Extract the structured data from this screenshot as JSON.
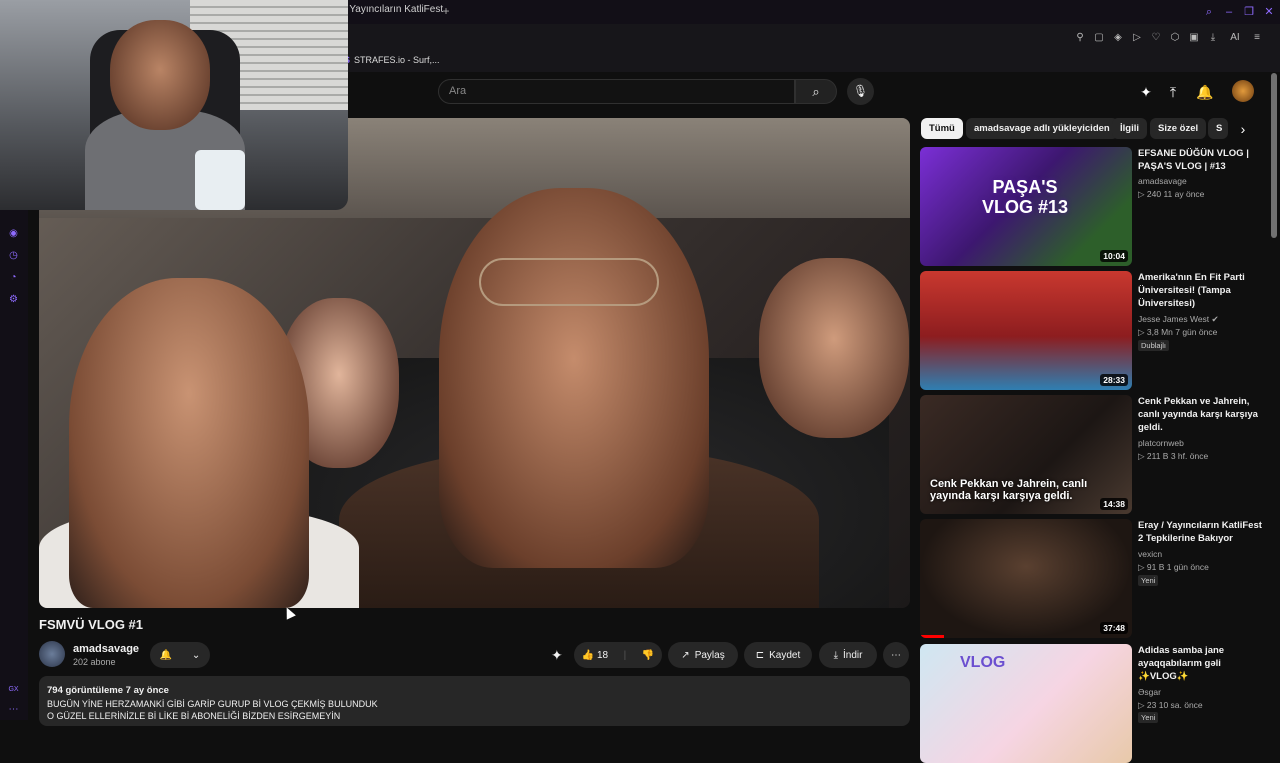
{
  "browser": {
    "tab_title": "/ Yayıncıların KatliFest",
    "new_tab": "+",
    "window_controls": [
      "search-icon",
      "minimize-icon",
      "restore-icon",
      "close-icon"
    ],
    "bookmark": {
      "icon_letter": "S",
      "label": "STRAFES.io - Surf,..."
    },
    "toolbar_ai_label": "AI",
    "accent": "#8f6bff"
  },
  "youtube": {
    "search_placeholder": "Ara",
    "video": {
      "title": "FSMVÜ VLOG #1",
      "channel": "amadsavage",
      "subscribers": "202 abone",
      "likes": "18",
      "share_label": "Paylaş",
      "save_label": "Kaydet",
      "download_label": "İndir",
      "views_date": "794 görüntüleme  7 ay önce",
      "description_lines": [
        "BUGÜN YİNE HERZAMANKİ GİBİ GARİP GURUP Bİ VLOG ÇEKMİŞ BULUNDUK",
        "O GÜZEL ELLERİNİZLE Bİ LİKE Bİ ABONELİĞİ BİZDEN ESİRGEMEYİN"
      ]
    },
    "chips": [
      "Tümü",
      "amadsavage adlı yükleyiciden",
      "İlgili",
      "Size özel",
      "S"
    ],
    "recommendations": [
      {
        "title": "EFSANE DÜĞÜN VLOG | PAŞA'S VLOG | #13",
        "channel": "amadsavage",
        "meta": "▷ 240  11 ay önce",
        "duration": "10:04",
        "thumb_text": "PAŞA'S VLOG #13",
        "badge": ""
      },
      {
        "title": "Amerika'nın En Fit Parti Üniversitesi! (Tampa Üniversitesi)",
        "channel": "Jesse James West",
        "meta": "▷ 3,8 Mn  7 gün önce",
        "duration": "28:33",
        "thumb_text": "",
        "badge": "Dublajlı"
      },
      {
        "title": "Cenk Pekkan ve Jahrein, canlı yayında karşı karşıya geldi.",
        "channel": "platcornweb",
        "meta": "▷ 211 B  3 hf. önce",
        "duration": "14:38",
        "thumb_text": "Cenk Pekkan ve Jahrein, canlı yayında karşı karşıya geldi.",
        "badge": ""
      },
      {
        "title": "Eray / Yayıncıların KatliFest 2 Tepkilerine Bakıyor",
        "channel": "vexicn",
        "meta": "▷ 91 B  1 gün önce",
        "duration": "37:48",
        "thumb_text": "",
        "badge": "Yeni"
      },
      {
        "title": "Adidas samba jane ayaqqabılarım gəli ✨VLOG✨",
        "channel": "Əsgar",
        "meta": "▷ 23  10 sa. önce",
        "duration": "",
        "thumb_text": "VLOG",
        "badge": "Yeni"
      }
    ]
  },
  "sidebar_label": "GX"
}
